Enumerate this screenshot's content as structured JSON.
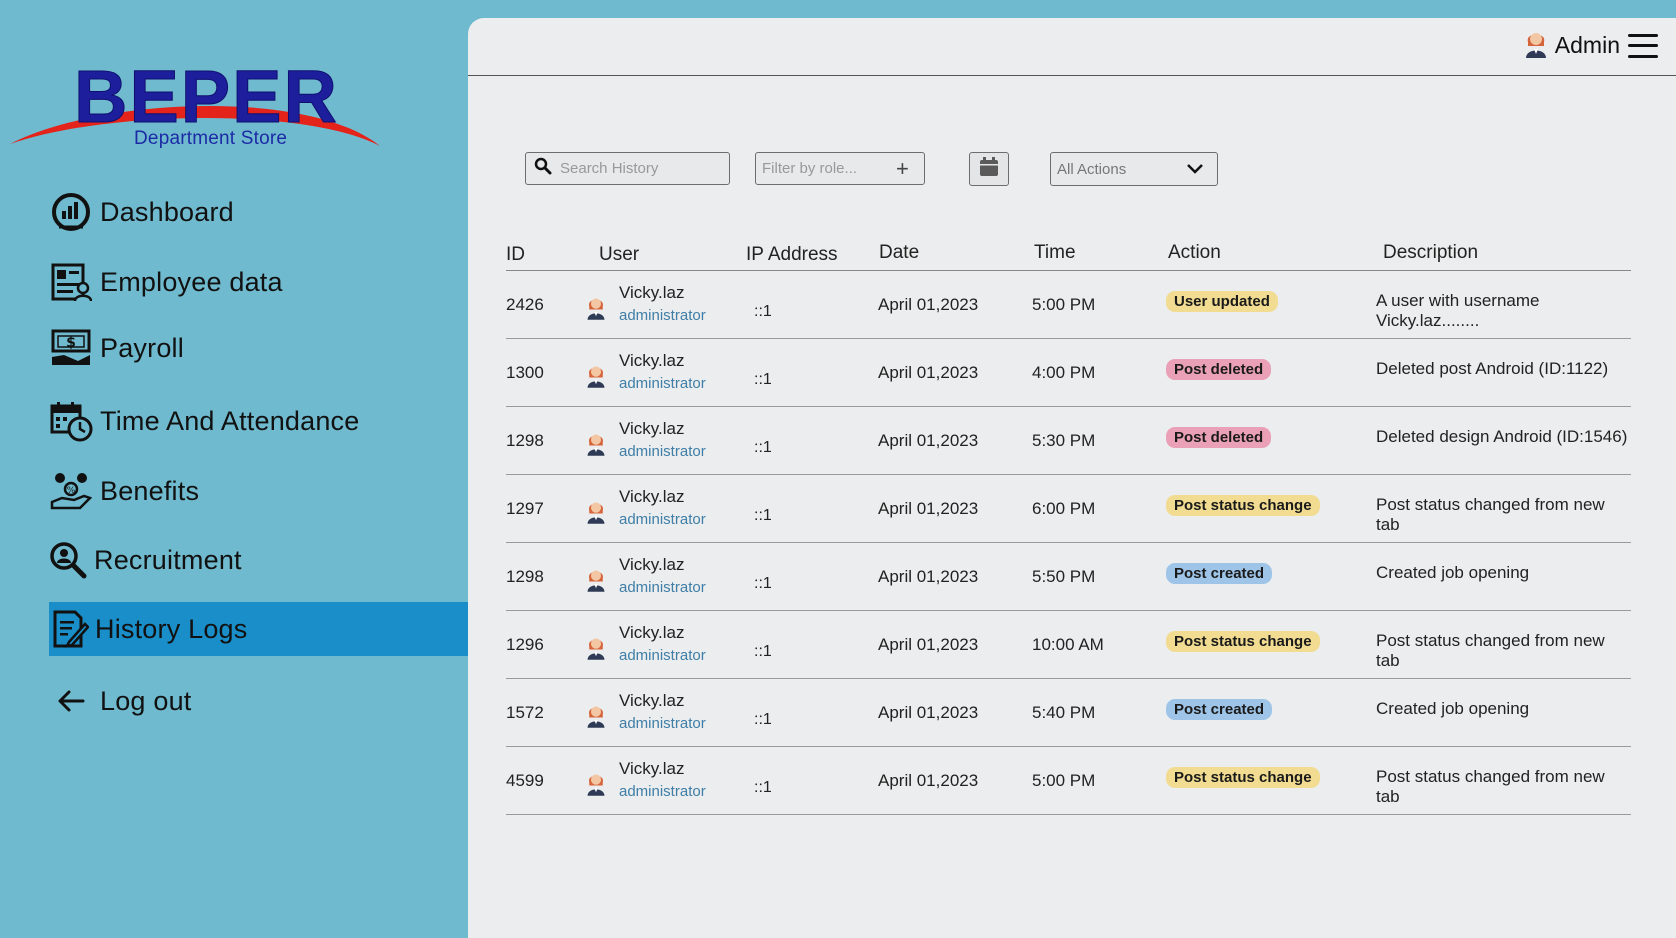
{
  "brand": {
    "name": "BEPER",
    "tagline": "Department Store"
  },
  "sidebar": {
    "items": [
      {
        "label": "Dashboard",
        "icon": "dashboard-gauge-icon"
      },
      {
        "label": "Employee data",
        "icon": "employee-data-icon"
      },
      {
        "label": "Payroll",
        "icon": "payroll-money-icon"
      },
      {
        "label": "Time And Attendance",
        "icon": "calendar-clock-icon"
      },
      {
        "label": "Benefits",
        "icon": "benefits-hand-icon"
      },
      {
        "label": "Recruitment",
        "icon": "recruitment-search-icon"
      },
      {
        "label": "History Logs",
        "icon": "history-logs-icon",
        "active": true
      },
      {
        "label": "Log out",
        "icon": "arrow-left-icon"
      }
    ],
    "active_color": "#1a8ec8",
    "background": "#6fbace"
  },
  "header": {
    "user_label": "Admin",
    "avatar_icon": "user-avatar-icon",
    "menu_icon": "hamburger-menu-icon"
  },
  "filters": {
    "search_placeholder": "Search History",
    "role_placeholder": "Filter by role...",
    "role_add_icon": "plus-icon",
    "calendar_icon": "calendar-icon",
    "actions_selected": "All Actions",
    "actions_dropdown_icon": "chevron-down-icon"
  },
  "table": {
    "headers": {
      "id": "ID",
      "user": "User",
      "ip": "IP Address",
      "date": "Date",
      "time": "Time",
      "action": "Action",
      "description": "Description"
    },
    "rows": [
      {
        "id": "2426",
        "user": "Vicky.laz",
        "role": "administrator",
        "ip": "::1",
        "date": "April 01,2023",
        "time": "5:00 PM",
        "action": "User updated",
        "action_type": "updated",
        "description": "A user with username Vicky.laz........"
      },
      {
        "id": "1300",
        "user": "Vicky.laz",
        "role": "administrator",
        "ip": "::1",
        "date": "April 01,2023",
        "time": "4:00 PM",
        "action": "Post deleted",
        "action_type": "deleted",
        "description": "Deleted post Android (ID:1122)"
      },
      {
        "id": "1298",
        "user": "Vicky.laz",
        "role": "administrator",
        "ip": "::1",
        "date": "April 01,2023",
        "time": "5:30 PM",
        "action": "Post deleted",
        "action_type": "deleted",
        "description": "Deleted design Android (ID:1546)"
      },
      {
        "id": "1297",
        "user": "Vicky.laz",
        "role": "administrator",
        "ip": "::1",
        "date": "April 01,2023",
        "time": "6:00 PM",
        "action": "Post status change",
        "action_type": "status",
        "description": "Post status changed from new tab"
      },
      {
        "id": "1298",
        "user": "Vicky.laz",
        "role": "administrator",
        "ip": "::1",
        "date": "April 01,2023",
        "time": "5:50 PM",
        "action": "Post created",
        "action_type": "created",
        "description": "Created job opening"
      },
      {
        "id": "1296",
        "user": "Vicky.laz",
        "role": "administrator",
        "ip": "::1",
        "date": "April 01,2023",
        "time": "10:00 AM",
        "action": "Post status change",
        "action_type": "status",
        "description": "Post status changed from new tab"
      },
      {
        "id": "1572",
        "user": "Vicky.laz",
        "role": "administrator",
        "ip": "::1",
        "date": "April 01,2023",
        "time": "5:40 PM",
        "action": "Post created",
        "action_type": "created",
        "description": "Created job opening"
      },
      {
        "id": "4599",
        "user": "Vicky.laz",
        "role": "administrator",
        "ip": "::1",
        "date": "April 01,2023",
        "time": "5:00 PM",
        "action": "Post status change",
        "action_type": "status",
        "description": "Post status changed from new tab"
      }
    ]
  },
  "colors": {
    "badge_updated": "#f1dc92",
    "badge_deleted": "#eaa1b8",
    "badge_status": "#f1dc92",
    "badge_created": "#9ec5e8",
    "role_text": "#3e7ea7"
  }
}
